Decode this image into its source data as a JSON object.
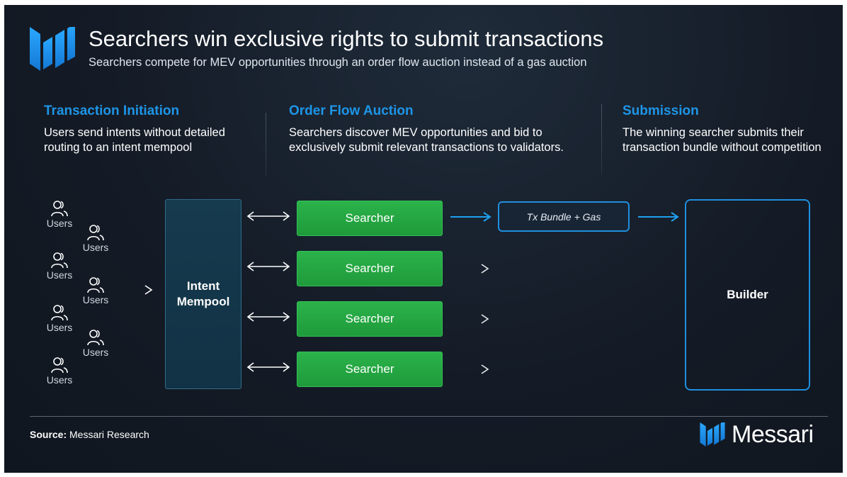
{
  "header": {
    "title": "Searchers win exclusive rights to submit transactions",
    "subtitle": "Searchers compete for MEV opportunities through an order flow auction instead of  a gas auction"
  },
  "sections": [
    {
      "heading": "Transaction Initiation",
      "text": "Users send intents without detailed routing to an intent mempool"
    },
    {
      "heading": "Order Flow Auction",
      "text": "Searchers discover MEV opportunities and bid to exclusively submit relevant transactions to validators."
    },
    {
      "heading": "Submission",
      "text": "The winning searcher submits their transaction bundle without competition"
    }
  ],
  "diagram": {
    "users": [
      "Users",
      "Users",
      "Users",
      "Users",
      "Users",
      "Users",
      "Users",
      "Users"
    ],
    "mempool_label": "Intent Mempool",
    "searchers": [
      "Searcher",
      "Searcher",
      "Searcher",
      "Searcher"
    ],
    "bundle_label": "Tx Bundle + Gas",
    "builder_label": "Builder"
  },
  "footer": {
    "source_label": "Source:",
    "source_value": "Messari Research",
    "brand": "Messari"
  },
  "colors": {
    "accent_blue": "#1e95e6",
    "searcher_green": "#22a541",
    "background": "#141b26"
  }
}
